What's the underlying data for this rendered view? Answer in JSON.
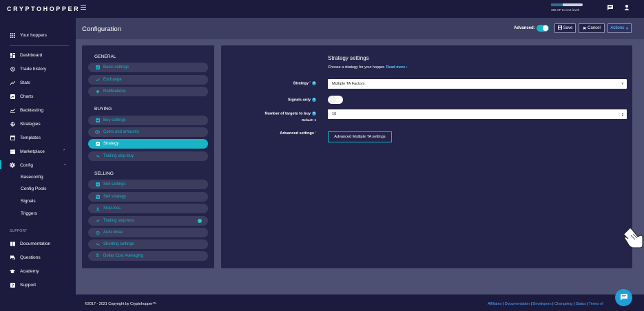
{
  "app": {
    "logo_text": "CRYPTOHOPPER"
  },
  "topbar": {
    "xp_progress": 0.38,
    "xp_text": "365 XP to next level!",
    "icons": [
      "menu-icon",
      "moon-icon",
      "chat-icon",
      "user-icon"
    ]
  },
  "sidebar": {
    "top_item": "Your hoppers",
    "items": [
      {
        "label": "Dashboard",
        "icon": "dashboard-icon"
      },
      {
        "label": "Trade history",
        "icon": "history-icon"
      },
      {
        "label": "Stats",
        "icon": "stats-icon"
      },
      {
        "label": "Charts",
        "icon": "charts-icon"
      },
      {
        "label": "Backtesting",
        "icon": "backtesting-icon"
      },
      {
        "label": "Strategies",
        "icon": "strategies-icon"
      },
      {
        "label": "Templates",
        "icon": "templates-icon"
      },
      {
        "label": "Marketplace",
        "icon": "marketplace-icon"
      },
      {
        "label": "Config",
        "icon": "gear-icon"
      }
    ],
    "config_sub": [
      "Baseconfig",
      "Config Pools",
      "Signals",
      "Triggers"
    ],
    "support_section": "SUPPORT",
    "support_items": [
      {
        "label": "Documentation",
        "icon": "book-icon"
      },
      {
        "label": "Questions",
        "icon": "questions-icon"
      },
      {
        "label": "Academy",
        "icon": "academy-icon"
      },
      {
        "label": "Support",
        "icon": "support-icon"
      }
    ]
  },
  "header": {
    "title": "Configuration",
    "advanced_label": "Advanced:",
    "advanced_on": true,
    "save_label": "Save",
    "cancel_label": "Cancel",
    "actions_label": "Actions"
  },
  "config_menu": {
    "general_title": "GENERAL",
    "general": [
      "Basic settings",
      "Exchange",
      "Notifications"
    ],
    "buying_title": "BUYING",
    "buying": [
      "Buy settings",
      "Coins and amounts",
      "Strategy",
      "Trailing stop-buy"
    ],
    "selling_title": "SELLING",
    "selling": [
      "Sell settings",
      "Sell strategy",
      "Stop-loss",
      "Trailing stop-loss",
      "Auto close",
      "Shorting settings",
      "Dollar Cost Averaging"
    ]
  },
  "strategy": {
    "title": "Strategy settings",
    "description": "Choose a strategy for your hopper.",
    "read_more": "Read more",
    "strategy_label": "Strategy",
    "strategy_value": "Multiple TA Factors",
    "signals_only_label": "Signals only",
    "signals_only_on": false,
    "targets_label": "Number of targets to buy",
    "targets_value": "10",
    "targets_default": "Default: 1",
    "advanced_settings_label": "Advanced settings",
    "advanced_button": "Advanced Multiple TA settings"
  },
  "footer": {
    "copyright": "©2017 - 2021 Copyright by Cryptohopper™",
    "links": [
      "Affiliates",
      "Documentation",
      "Developers",
      "Changelog",
      "Status",
      "Terms of"
    ]
  },
  "colors": {
    "accent": "#19b4c8",
    "sidebar_bg": "#1c1b3d",
    "panel_bg": "#24244a",
    "page_bg": "#4d4f73"
  }
}
